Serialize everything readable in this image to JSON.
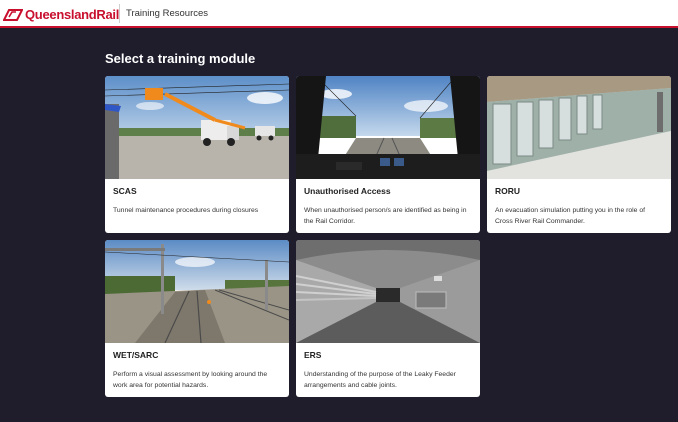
{
  "header": {
    "brand": "QueenslandRail",
    "app_title": "Training Resources",
    "brand_color": "#c8102e"
  },
  "main": {
    "heading": "Select a training module",
    "modules": [
      {
        "title": "SCAS",
        "description": "Tunnel maintenance procedures during closures",
        "thumbnail": "boom-lift-scene"
      },
      {
        "title": "Unauthorised Access",
        "description": "When unauthorised person/s are identified as being in the Rail Corridor.",
        "thumbnail": "cab-view-scene"
      },
      {
        "title": "RORU",
        "description": "An evacuation simulation putting you in the role of Cross River Rail Commander.",
        "thumbnail": "platform-screen-doors-scene"
      },
      {
        "title": "WET/SARC",
        "description": "Perform a visual assessment by looking around the work area for potential hazards.",
        "thumbnail": "track-corridor-scene"
      },
      {
        "title": "ERS",
        "description": "Understanding of the purpose of the Leaky Feeder arrangements and cable joints.",
        "thumbnail": "tunnel-cables-scene"
      }
    ]
  },
  "colors": {
    "page_bg": "#1f1c2c",
    "card_bg": "#ffffff"
  }
}
